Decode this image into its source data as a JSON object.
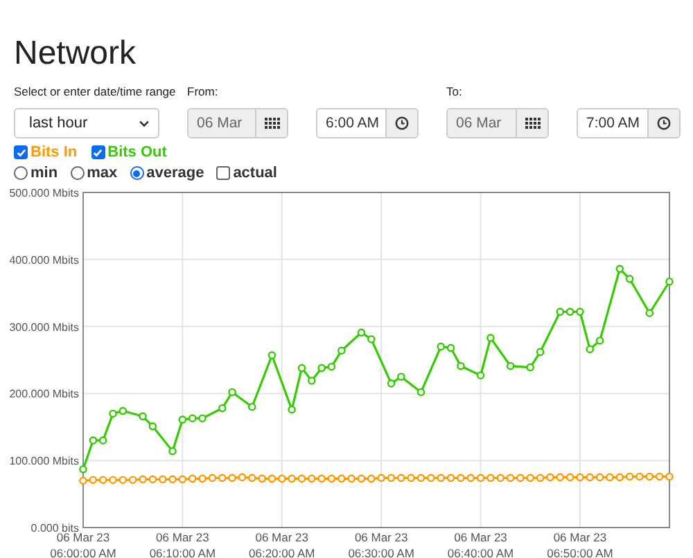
{
  "title": "Network",
  "range": {
    "label": "Select or enter date/time range",
    "value": "last hour"
  },
  "from": {
    "label": "From:",
    "date": "06 Mar",
    "time": "6:00 AM"
  },
  "to": {
    "label": "To:",
    "date": "06 Mar",
    "time": "7:00 AM"
  },
  "series_toggles": [
    {
      "label": "Bits In",
      "checked": true,
      "color": "#ff9900"
    },
    {
      "label": "Bits Out",
      "checked": true,
      "color": "#33cc00"
    }
  ],
  "modes": [
    {
      "label": "min",
      "kind": "radio",
      "selected": false
    },
    {
      "label": "max",
      "kind": "radio",
      "selected": false
    },
    {
      "label": "average",
      "kind": "radio",
      "selected": true
    },
    {
      "label": "actual",
      "kind": "checkbox",
      "selected": false
    }
  ],
  "chart_data": {
    "type": "line",
    "grid": true,
    "categories": [
      "06 Mar 23 06:00:00 AM",
      null,
      null,
      null,
      null,
      null,
      null,
      null,
      null,
      null,
      "06 Mar 23 06:10:00 AM",
      null,
      null,
      null,
      null,
      null,
      null,
      null,
      null,
      null,
      "06 Mar 23 06:20:00 AM",
      null,
      null,
      null,
      null,
      null,
      null,
      null,
      null,
      null,
      "06 Mar 23 06:30:00 AM",
      null,
      null,
      null,
      null,
      null,
      null,
      null,
      null,
      null,
      "06 Mar 23 06:40:00 AM",
      null,
      null,
      null,
      null,
      null,
      null,
      null,
      null,
      null,
      "06 Mar 23 06:50:00 AM",
      null,
      null,
      null,
      null,
      null,
      null,
      null,
      null,
      null
    ],
    "ylim": [
      0,
      500
    ],
    "yticks": [
      {
        "value": 0,
        "label": "0.000 bits"
      },
      {
        "value": 100,
        "label": "100.000 Mbits"
      },
      {
        "value": 200,
        "label": "200.000 Mbits"
      },
      {
        "value": 300,
        "label": "300.000 Mbits"
      },
      {
        "value": 400,
        "label": "400.000 Mbits"
      },
      {
        "value": 500,
        "label": "500.000 Mbits"
      }
    ],
    "series": [
      {
        "color": "#ff9900",
        "marker": "circle",
        "values": [
          70,
          71,
          71,
          71,
          71,
          71,
          72,
          72,
          72,
          72,
          72,
          73,
          73,
          74,
          74,
          74,
          75,
          74,
          73,
          73,
          73,
          73,
          73,
          73,
          73,
          73,
          73,
          73,
          73,
          73,
          74,
          74,
          74,
          74,
          74,
          74,
          74,
          74,
          74,
          74,
          74,
          74,
          74,
          74,
          74,
          74,
          74,
          75,
          75,
          75,
          75,
          75,
          75,
          75,
          75,
          76,
          76,
          76,
          76,
          76
        ]
      },
      {
        "color": "#33cc00",
        "marker": "circle",
        "values": [
          87,
          130,
          130,
          170,
          174,
          null,
          166,
          151,
          null,
          114,
          161,
          163,
          163,
          null,
          178,
          202,
          null,
          180,
          null,
          257,
          null,
          176,
          238,
          219,
          238,
          240,
          264,
          null,
          291,
          281,
          null,
          215,
          225,
          null,
          202,
          null,
          270,
          268,
          241,
          null,
          227,
          283,
          null,
          241,
          null,
          239,
          262,
          null,
          322,
          322,
          322,
          266,
          279,
          null,
          386,
          371,
          null,
          320,
          null,
          367
        ]
      }
    ]
  }
}
